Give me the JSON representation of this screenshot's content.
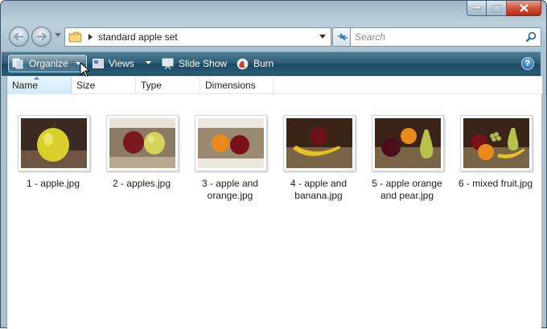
{
  "window": {
    "caption_buttons": [
      "minimize",
      "maximize",
      "close"
    ]
  },
  "address_bar": {
    "path": "standard apple set"
  },
  "search": {
    "placeholder": "Search"
  },
  "toolbar": {
    "organize_label": "Organize",
    "views_label": "Views",
    "slideshow_label": "Slide Show",
    "burn_label": "Burn",
    "help_label": "?"
  },
  "columns": {
    "name": "Name",
    "size": "Size",
    "type": "Type",
    "dimensions": "Dimensions"
  },
  "files": [
    {
      "label_line1": "1 - apple.jpg",
      "label_line2": ""
    },
    {
      "label_line1": "2 - apples.jpg",
      "label_line2": ""
    },
    {
      "label_line1": "3 - apple and",
      "label_line2": "orange.jpg"
    },
    {
      "label_line1": "4 - apple and",
      "label_line2": "banana.jpg"
    },
    {
      "label_line1": "5 - apple orange",
      "label_line2": "and pear.jpg"
    },
    {
      "label_line1": "6 - mixed fruit.jpg",
      "label_line2": ""
    }
  ],
  "icons": {
    "back": "back-arrow-icon",
    "forward": "forward-arrow-icon",
    "folder": "folder-icon",
    "refresh": "refresh-icon",
    "search": "magnifier-icon",
    "organize": "organize-icon",
    "views": "views-icon",
    "slideshow": "slideshow-icon",
    "burn": "burn-disc-icon",
    "help": "help-icon"
  }
}
